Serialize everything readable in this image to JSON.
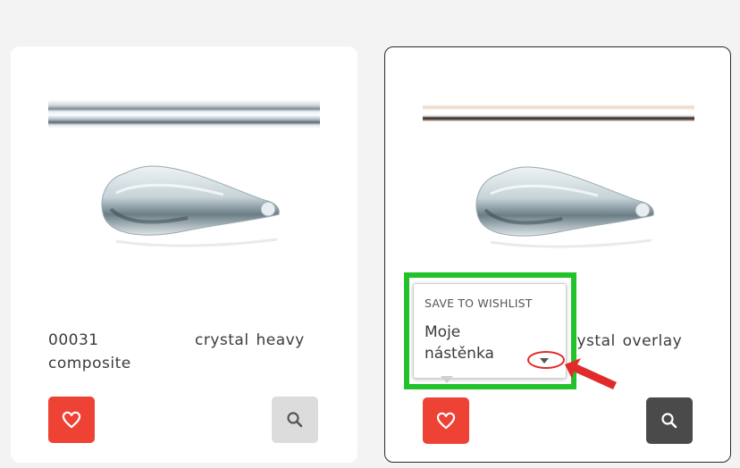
{
  "products": [
    {
      "code": "00031",
      "name_line1": "crystal heavy",
      "name_line2": "composite",
      "wishlist_icon": "heart-icon",
      "search_icon": "magnifier-icon",
      "search_button_color": "#dcdcdc"
    },
    {
      "name_visible": "rystal overlay",
      "wishlist_icon": "heart-icon",
      "search_icon": "magnifier-icon",
      "search_button_color": "#4a4a4a"
    }
  ],
  "wishlist_popup": {
    "title": "SAVE TO WISHLIST",
    "board_line1": "Moje",
    "board_line2": "nástěnka",
    "dropdown_icon": "caret-down-icon"
  },
  "colors": {
    "wishlist_button": "#ee4235",
    "annotation_frame": "#22c22a",
    "annotation_marker": "#e12a2a"
  }
}
